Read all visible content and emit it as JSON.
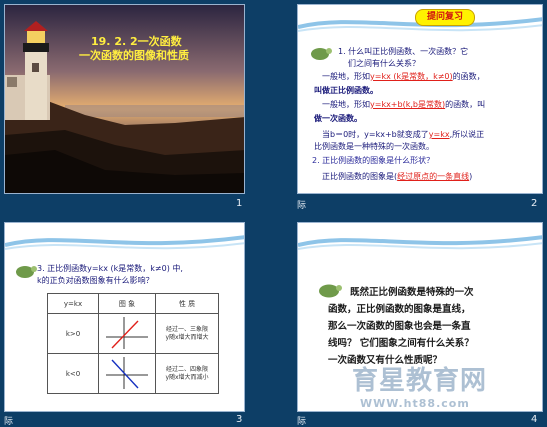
{
  "slide1": {
    "title_line1": "19. 2. 2一次函数",
    "title_line2": "一次函数的图像和性质",
    "number": "1"
  },
  "slide2": {
    "badge": "提问复习",
    "q1": "1.  什么叫正比例函数、一次函数？它",
    "q1b": "们之间有什么关系？",
    "l1a": "一般地，形如",
    "l1b": "y=kx (k是常数，k≠0)",
    "l1c": "的函数，",
    "l2": "叫做正比例函数。",
    "l3a": "一般地，形如",
    "l3b": "y=kx+b(k,b是常数)",
    "l3c": "的函数，叫",
    "l4": "做一次函数。",
    "l5a": "当b＝0时，y=kx+b就变成了",
    "l5b": "y=kx",
    "l5c": ",所以说正",
    "l6": "比例函数是一种特殊的一次函数。",
    "q2": "2. 正比例函数的图象是什么形状？",
    "l7a": "正比例函数的图象是(",
    "l7b": "经过原点的一条直线",
    "l7c": ")",
    "number": "2",
    "mark": "际"
  },
  "slide3": {
    "q3": "3. 正比例函数y=kx (k是常数，k≠0) 中,",
    "q3b": "k的正负对函数图象有什么影响？",
    "table": {
      "headers": [
        "y=kx",
        "图  象",
        "性  质"
      ],
      "rows": [
        {
          "cond": "k>0",
          "prop": "经过一、三象限\ny随x增大而增大"
        },
        {
          "cond": "k<0",
          "prop": "经过二、四象限\ny随x增大而减小"
        }
      ]
    },
    "number": "3",
    "mark": "际"
  },
  "slide4": {
    "p1": "既然正比例函数是特殊的一次",
    "p2": "函数，正比例函数的图象是直线，",
    "p3": "那么一次函数的图象也会是一条直",
    "p4": "线吗？ 它们图象之间有什么关系？",
    "p5": "一次函数又有什么性质呢？",
    "number": "4",
    "mark": "际"
  },
  "watermark": {
    "main": "育星教育网",
    "sub": "WWW.ht88.com"
  },
  "colors": {
    "frame_bg": "#0d3e66",
    "text_navy": "#1a1a7a",
    "accent_red": "#e0201a",
    "accent_blue": "#1530c0",
    "badge_yellow": "#fff200"
  }
}
